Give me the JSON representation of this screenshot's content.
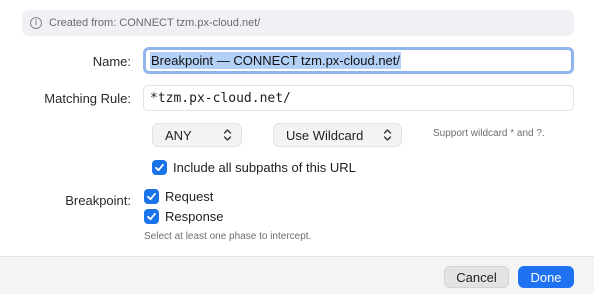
{
  "banner": {
    "text": "Created from: CONNECT tzm.px-cloud.net/",
    "icon": "info-icon"
  },
  "form": {
    "name_label": "Name:",
    "name_value": "Breakpoint — CONNECT tzm.px-cloud.net/",
    "matching_rule_label": "Matching Rule:",
    "matching_rule_value": "*tzm.px-cloud.net/",
    "method_select": {
      "selected": "ANY"
    },
    "wildcard_select": {
      "selected": "Use Wildcard"
    },
    "wildcard_hint": "Support wildcard * and ?.",
    "include_subpaths_label": "Include all subpaths of this URL",
    "include_subpaths_checked": true,
    "breakpoint_label": "Breakpoint:",
    "request_label": "Request",
    "request_checked": true,
    "response_label": "Response",
    "response_checked": true,
    "phase_hint": "Select at least one phase to intercept."
  },
  "footer": {
    "cancel_label": "Cancel",
    "done_label": "Done"
  },
  "colors": {
    "accent": "#1f73f2",
    "checkbox": "#1a73e8",
    "focus_ring": "#8fb4ee",
    "selection": "#b3d0f7"
  }
}
